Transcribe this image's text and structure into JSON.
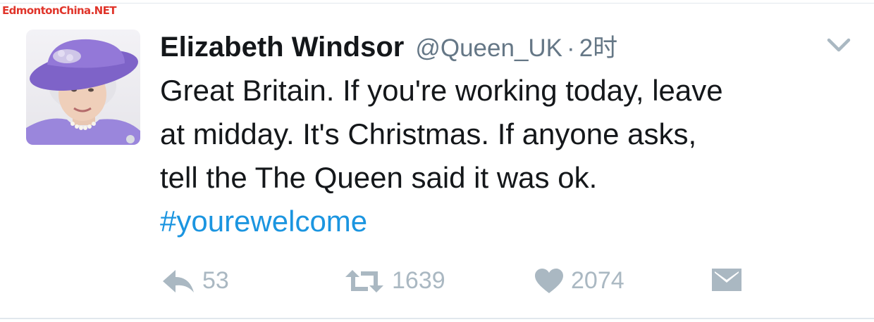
{
  "watermark": "EdmontonChina.NET",
  "tweet": {
    "display_name": "Elizabeth Windsor",
    "handle": "@Queen_UK",
    "separator": "·",
    "time": "2时",
    "text_lines": [
      "Great Britain. If you're working today, leave",
      "at midday. It's Christmas. If anyone asks,",
      "tell the The Queen said it was ok."
    ],
    "hashtag": "#yourewelcome"
  },
  "actions": {
    "reply_count": "53",
    "retweet_count": "1639",
    "like_count": "2074"
  },
  "icons": {
    "reply": "reply-icon",
    "retweet": "retweet-icon",
    "like": "heart-icon",
    "message": "envelope-icon",
    "menu": "chevron-down-icon"
  },
  "colors": {
    "text": "#14171a",
    "secondary": "#657786",
    "action_gray": "#aab8c2",
    "hashtag": "#1b95e0",
    "watermark": "#e0352b",
    "avatar_hat": "#8e73d6"
  }
}
